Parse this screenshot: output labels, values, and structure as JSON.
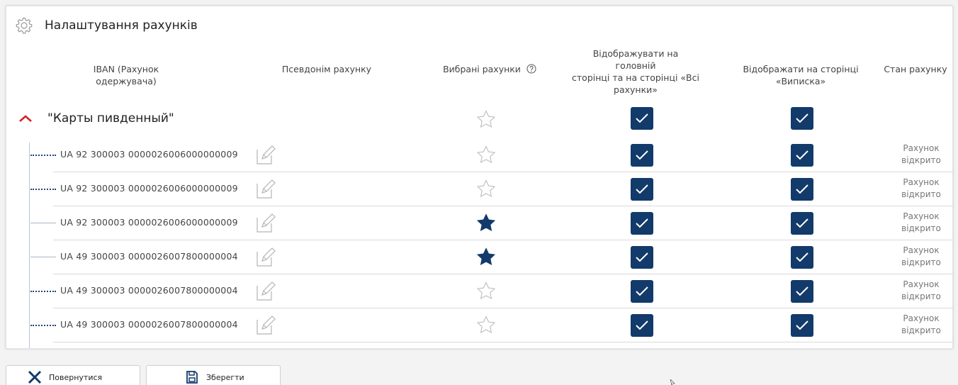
{
  "page": {
    "title": "Налаштування рахунків",
    "title_icon": "gear-icon"
  },
  "columns": {
    "iban": "IBAN (Рахунок одержувача)",
    "alias": "Псевдонім рахунку",
    "favorites": "Вибрані рахунки",
    "favorites_help_icon": "help-circle-icon",
    "show_main_line1": "Відображувати на головній",
    "show_main_line2": "сторінці та на сторінці «Всі",
    "show_main_line3": "рахунки»",
    "show_statement": "Відображати на сторінці «Виписка»",
    "status": "Стан рахунку"
  },
  "group": {
    "name": "\"Карты пивденный\"",
    "expanded": true,
    "favorite": false,
    "show_main": true,
    "show_statement": true
  },
  "accounts": [
    {
      "iban": "UA 92 300003 0000026006000000009",
      "favorite": false,
      "show_main": true,
      "show_statement": true,
      "status_line1": "Рахунок",
      "status_line2": "відкрито",
      "lead": "dots"
    },
    {
      "iban": "UA 92 300003 0000026006000000009",
      "favorite": false,
      "show_main": true,
      "show_statement": true,
      "status_line1": "Рахунок",
      "status_line2": "відкрито",
      "lead": "dots"
    },
    {
      "iban": "UA 92 300003 0000026006000000009",
      "favorite": true,
      "show_main": true,
      "show_statement": true,
      "status_line1": "Рахунок",
      "status_line2": "відкрито",
      "lead": "thin"
    },
    {
      "iban": "UA 49 300003 0000026007800000004",
      "favorite": true,
      "show_main": true,
      "show_statement": true,
      "status_line1": "Рахунок",
      "status_line2": "відкрито",
      "lead": "thin"
    },
    {
      "iban": "UA 49 300003 0000026007800000004",
      "favorite": false,
      "show_main": true,
      "show_statement": true,
      "status_line1": "Рахунок",
      "status_line2": "відкрито",
      "lead": "dots"
    },
    {
      "iban": "UA 49 300003 0000026007800000004",
      "favorite": false,
      "show_main": true,
      "show_statement": true,
      "status_line1": "Рахунок",
      "status_line2": "відкрито",
      "lead": "dots"
    }
  ],
  "buttons": {
    "back_label": "Повернутися",
    "back_icon": "close-icon",
    "save_label": "Зберегти",
    "save_icon": "save-icon"
  },
  "colors": {
    "accent_navy": "#123a6b",
    "chevron_red": "#d0242b",
    "star_empty": "#bdbdbd",
    "star_filled": "#123a6b"
  }
}
